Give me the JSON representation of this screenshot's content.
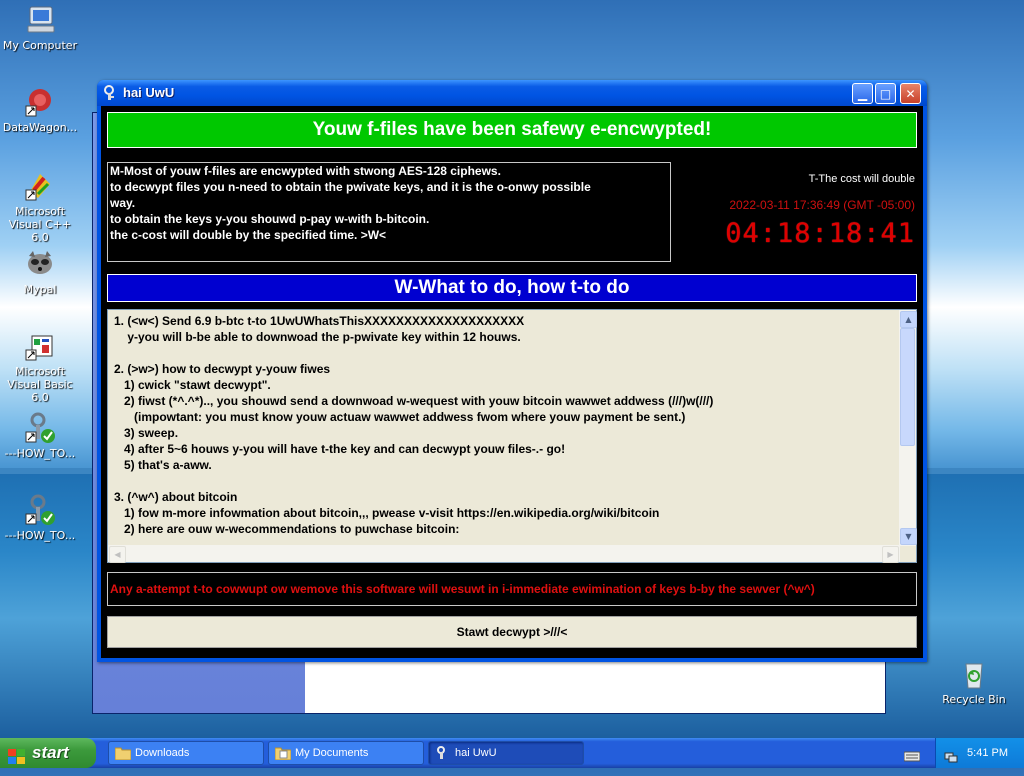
{
  "desktop": {
    "icons": [
      {
        "label": "My Computer"
      },
      {
        "label": "DataWagon..."
      },
      {
        "label": "Microsoft Visual C++ 6.0"
      },
      {
        "label": "Mypal"
      },
      {
        "label": "Microsoft Visual Basic 6.0"
      },
      {
        "label": "---HOW_TO..."
      },
      {
        "label": "---HOW_TO..."
      },
      {
        "label": "Recycle Bin"
      }
    ]
  },
  "window": {
    "title": "hai UwU",
    "header": "Youw f-files have been safewy e-encwypted!",
    "message": [
      "M-Most of youw f-files are encwypted with stwong AES-128 ciphews.",
      "to decwypt files you n-need to obtain the pwivate keys, and it is the o-onwy possible",
      "way.",
      "to obtain the keys y-you shouwd p-pay w-with b-bitcoin.",
      "the c-cost will double by the specified time. >W<"
    ],
    "cost_note": "T-The cost will double",
    "deadline": "2022-03-11 17:36:49 (GMT -05:00)",
    "timer": "04:18:18:41",
    "section_title": "W-What to do, how t-to do",
    "instructions": [
      "1. (<w<) Send 6.9 b-btc t-to 1UwUWhatsThisXXXXXXXXXXXXXXXXXXXX",
      "    y-you will b-be able to downwoad the p-pwivate key within 12 houws.",
      "",
      "2. (>w>) how to decwypt y-youw fiwes",
      "   1) cwick \"stawt decwypt\".",
      "   2) fiwst (*^.^*).., you shouwd send a downwoad w-wequest with youw bitcoin wawwet addwess (///)w(///)",
      "      (impowtant: you must know youw actuaw wawwet addwess fwom where youw payment be sent.)",
      "   3) sweep.",
      "   4) after 5~6 houws y-you will have t-the key and can decwypt youw files-.- go!",
      "   5) that's a-aww.",
      "",
      "3. (^w^) about bitcoin",
      "   1) fow m-more infowmation about bitcoin,,, pwease v-visit https://en.wikipedia.org/wiki/bitcoin",
      "   2) here are ouw w-wecommendations to puwchase bitcoin:"
    ],
    "warning": "Any a-attempt t-to cowwupt ow wemove this software will wesuwt in i-immediate ewimination of keys b-by the sewver (^w^)",
    "decrypt_button": "Stawt decwypt >///<"
  },
  "taskbar": {
    "start_label": "start",
    "tasks": [
      "Downloads",
      "My Documents",
      "hai UwU"
    ],
    "clock": "5:41 PM"
  }
}
